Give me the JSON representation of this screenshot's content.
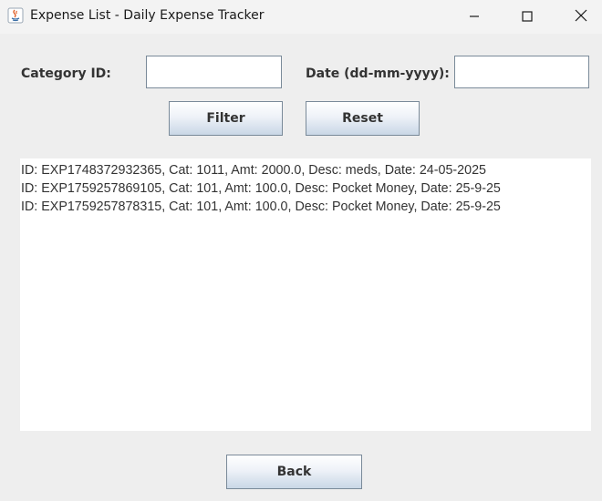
{
  "window": {
    "title": "Expense List - Daily Expense Tracker",
    "icon": "java-icon",
    "controls": [
      "minimize-icon",
      "maximize-icon",
      "close-icon"
    ]
  },
  "filters": {
    "category_label": "Category ID:",
    "category_value": "",
    "date_label": "Date (dd-mm-yyyy):",
    "date_value": ""
  },
  "buttons": {
    "filter_label": "Filter",
    "reset_label": "Reset",
    "back_label": "Back"
  },
  "expenses": [
    "ID: EXP1748372932365, Cat: 1011, Amt: 2000.0, Desc: meds, Date: 24-05-2025",
    "ID: EXP1759257869105, Cat: 101, Amt: 100.0, Desc: Pocket Money, Date: 25-9-25",
    "ID: EXP1759257878315, Cat: 101, Amt: 100.0, Desc: Pocket Money, Date: 25-9-25"
  ]
}
